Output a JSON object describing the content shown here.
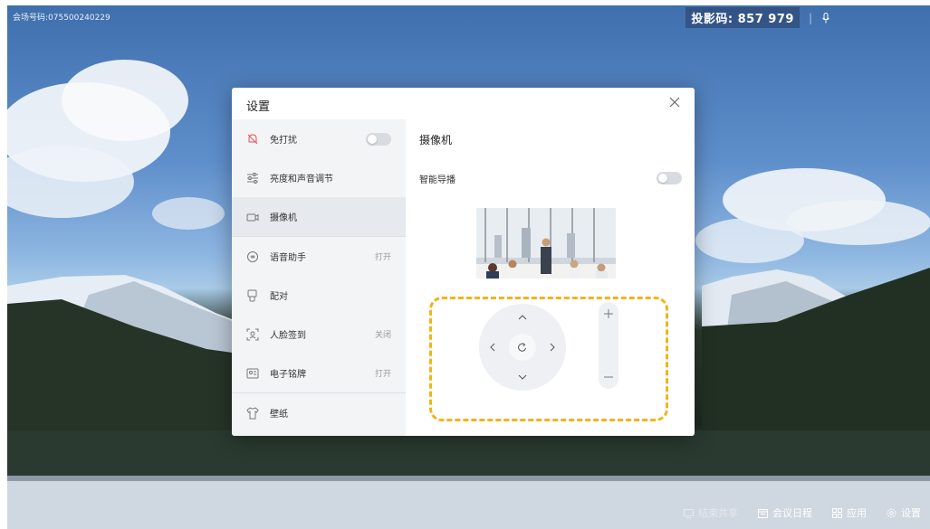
{
  "meeting_number": "会场号码:075500240229",
  "projection": {
    "label": "投影码",
    "separator": ":",
    "code": "857 979"
  },
  "topbar_separator": "|",
  "dialog": {
    "title": "设置"
  },
  "sidebar": {
    "items": [
      {
        "label": "免打扰",
        "icon": "bell-off-icon",
        "status": ""
      },
      {
        "label": "亮度和声音调节",
        "icon": "sliders-icon",
        "status": ""
      },
      {
        "label": "摄像机",
        "icon": "camera-icon",
        "status": ""
      },
      {
        "label": "语音助手",
        "icon": "voice-assistant-icon",
        "status": "打开"
      },
      {
        "label": "配对",
        "icon": "pairing-icon",
        "status": ""
      },
      {
        "label": "人脸签到",
        "icon": "face-checkin-icon",
        "status": "关闭"
      },
      {
        "label": "电子铭牌",
        "icon": "nameplate-icon",
        "status": "打开"
      },
      {
        "label": "壁纸",
        "icon": "tshirt-icon",
        "status": ""
      }
    ],
    "active": "摄像机",
    "do_not_disturb_on": false
  },
  "camera": {
    "title": "摄像机",
    "smart_director_label": "智能导播",
    "smart_director_on": false
  },
  "bottombar": {
    "items": [
      {
        "label": "结束共享",
        "icon": "share-stop-icon"
      },
      {
        "label": "会议日程",
        "icon": "calendar-icon"
      },
      {
        "label": "应用",
        "icon": "apps-grid-icon"
      },
      {
        "label": "设置",
        "icon": "gear-icon"
      }
    ]
  },
  "colors": {
    "highlight": "#f2b31a",
    "sidebar_bg": "#f3f4f6",
    "active_bg": "#e6e9ee"
  }
}
